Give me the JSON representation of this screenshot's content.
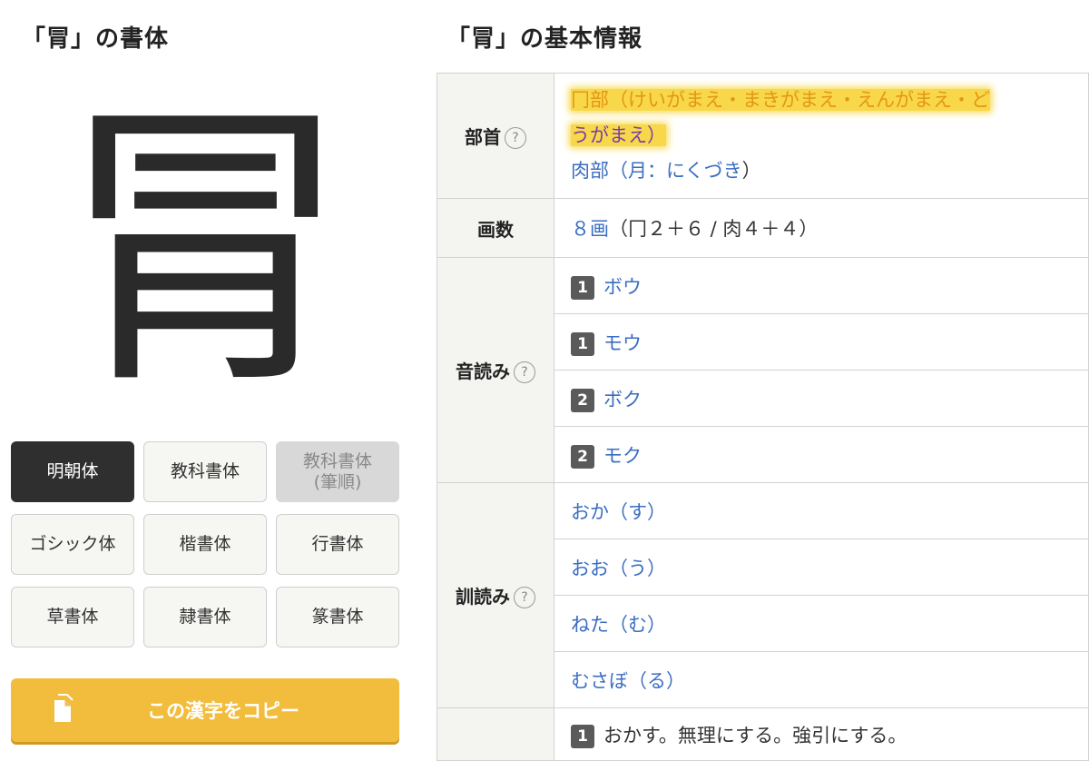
{
  "left_section": {
    "title": "「冐」の書体",
    "kanji": "冐"
  },
  "font_buttons": [
    {
      "label": "明朝体",
      "state": "active"
    },
    {
      "label": "教科書体",
      "state": "normal"
    },
    {
      "label": "教科書体\n(筆順)",
      "state": "disabled"
    },
    {
      "label": "ゴシック体",
      "state": "normal"
    },
    {
      "label": "楷書体",
      "state": "normal"
    },
    {
      "label": "行書体",
      "state": "normal"
    },
    {
      "label": "草書体",
      "state": "normal"
    },
    {
      "label": "隷書体",
      "state": "normal"
    },
    {
      "label": "篆書体",
      "state": "normal"
    }
  ],
  "copy_button": {
    "label": "この漢字をコピー",
    "icon": "document-copy-icon"
  },
  "right_section": {
    "title": "「冐」の基本情報"
  },
  "info": {
    "radical": {
      "label": "部首",
      "line1": "冂部（けいがまえ・まきがまえ・えんがまえ・ど",
      "line2": "うがまえ）",
      "second_link": "肉部",
      "second_open": "（",
      "second_mid": "月：にくづき",
      "second_close": "）"
    },
    "strokes": {
      "label": "画数",
      "link": "８画",
      "detail": "（冂２＋６ / 肉４＋４）"
    },
    "onyomi": {
      "label": "音読み",
      "items": [
        {
          "level": "1",
          "text": "ボウ"
        },
        {
          "level": "1",
          "text": "モウ"
        },
        {
          "level": "2",
          "text": "ボク"
        },
        {
          "level": "2",
          "text": "モク"
        }
      ]
    },
    "kunyomi": {
      "label": "訓読み",
      "items": [
        "おか（す）",
        "おお（う）",
        "ねた（む）",
        "むさぼ（る）"
      ]
    },
    "meaning": {
      "level": "1",
      "text": "おかす。無理にする。強引にする。"
    }
  },
  "colors": {
    "link": "#3b6ec2",
    "highlight": "#f8d84a",
    "copy_button": "#f2bc3c",
    "active_button": "#2f2f2f"
  }
}
